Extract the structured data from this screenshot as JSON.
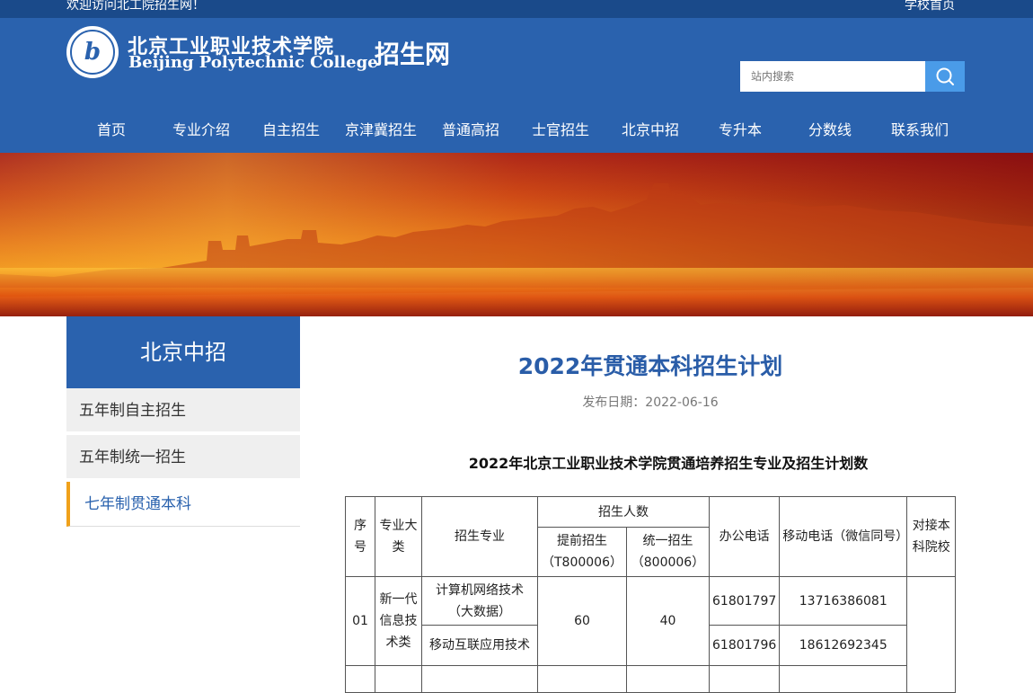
{
  "topbar": {
    "welcome": "欢迎访问北工院招生网！",
    "home_link": "学校首页"
  },
  "header": {
    "logo_mark": "b",
    "school_name_cn": "北京工业职业技术学院",
    "school_name_en": "Beijing Polytechnic College",
    "site_name": "招生网"
  },
  "search": {
    "placeholder": "站内搜索",
    "icon": "search-icon"
  },
  "nav": {
    "items": [
      "首页",
      "专业介绍",
      "自主招生",
      "京津冀招生",
      "普通高招",
      "士官招生",
      "北京中招",
      "专升本",
      "分数线",
      "联系我们"
    ]
  },
  "sidebar": {
    "title": "北京中招",
    "items": [
      {
        "label": "五年制自主招生",
        "active": false
      },
      {
        "label": "五年制统一招生",
        "active": false
      },
      {
        "label": "七年制贯通本科",
        "active": true
      }
    ]
  },
  "article": {
    "title": "2022年贯通本科招生计划",
    "date_label": "发布日期：2022-06-16",
    "table_title": "2022年北京工业职业技术学院贯通培养招生专业及招生计划数"
  },
  "table": {
    "headers": {
      "seq": "序号",
      "category": "专业大类",
      "major": "招生专业",
      "enroll": "招生人数",
      "advance": "提前招生（T800006）",
      "unified": "统一招生（800006）",
      "office_phone": "办公电话",
      "mobile": "移动电话（微信同号）",
      "partner": "对接本科院校"
    },
    "rows": [
      {
        "seq": "01",
        "category": "新一代信息技术类",
        "advance": "60",
        "unified": "40",
        "majors": [
          {
            "name": "计算机网络技术（大数据）",
            "office": "61801797",
            "mobile": "13716386081"
          },
          {
            "name": "移动互联应用技术",
            "office": "61801796",
            "mobile": "18612692345"
          }
        ]
      }
    ]
  },
  "colors": {
    "brand_blue": "#2a62ae",
    "topbar_blue": "#1a4a8a",
    "title_blue": "#2a5da8",
    "accent_orange": "#f0a11a",
    "search_button": "#4a9be8"
  }
}
